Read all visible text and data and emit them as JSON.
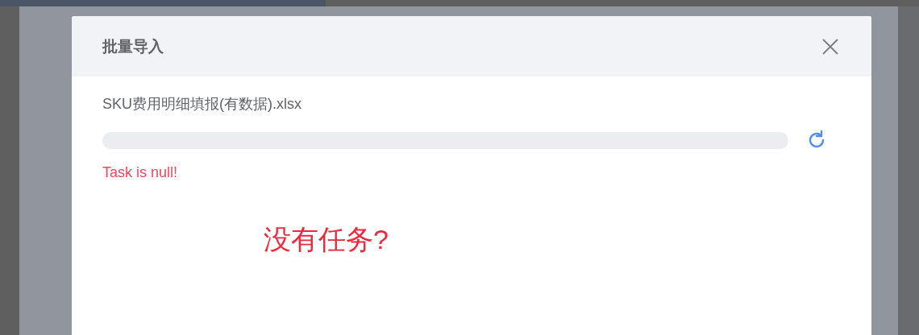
{
  "dialog": {
    "title": "批量导入",
    "file_name": "SKU费用明细填报(有数据).xlsx",
    "progress": {
      "level": 0
    },
    "error": "Task is null!",
    "annotation": "没有任务?"
  }
}
